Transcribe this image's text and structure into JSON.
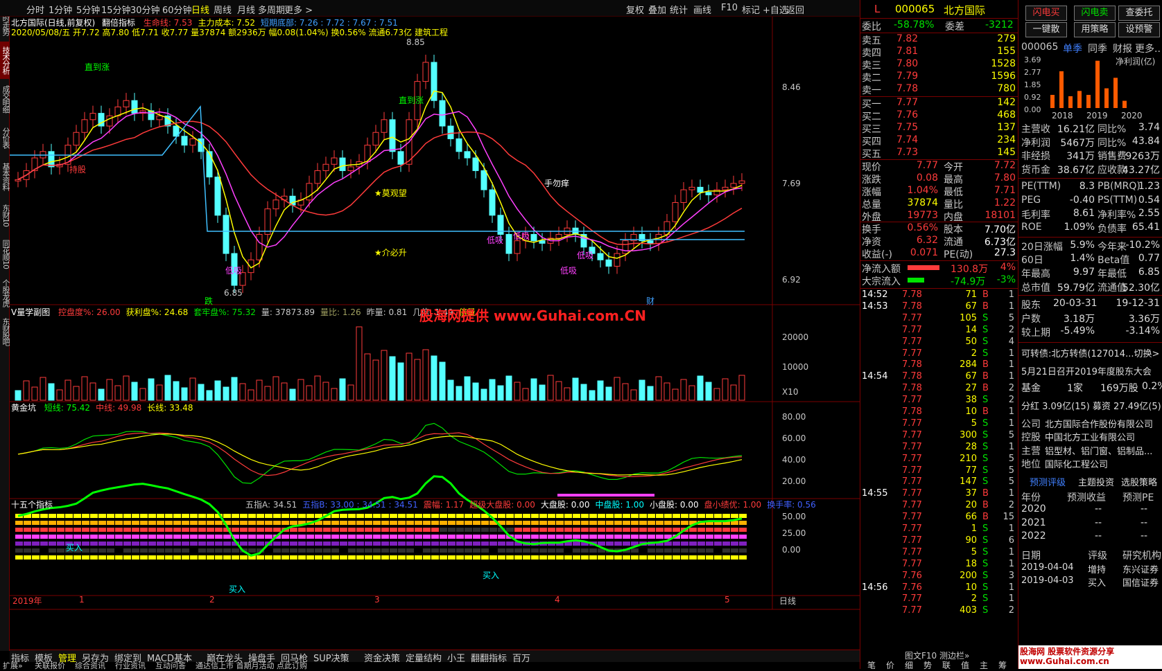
{
  "topbar": {
    "periods": [
      "分时",
      "1分钟",
      "5分钟",
      "15分钟",
      "30分钟",
      "60分钟",
      "日线",
      "周线",
      "月线",
      "多周期",
      "更多 >"
    ],
    "active": "日线",
    "tools": [
      "复权",
      "叠加",
      "统计",
      "画线",
      "F10",
      "标记",
      "+自选",
      "返回"
    ]
  },
  "leftnav": [
    "分时走势",
    "技术分析",
    "成交明细",
    "分价表",
    "基本资料",
    "东财10",
    "同花顺10",
    "个股龙虎",
    "东财股吧"
  ],
  "main": {
    "title": "北方国际(日线,前复权)",
    "indicator": "翻倍指标",
    "ind_values": [
      {
        "t": "生命线: 7.53",
        "c": "#ff3b3b"
      },
      {
        "t": "主力成本: 7.52",
        "c": "#ffff00"
      },
      {
        "t": "短期底部: 7.26 : 7.72 : 7.67 : 7.51",
        "c": "#40a0ff"
      }
    ],
    "ohlc": "2020/05/08/五 开7.72 高7.80 低7.71 收7.77 量37874 额2936万 幅0.08(1.04%) 换0.56% 流通6.73亿 建筑工程",
    "price_labels": [
      "8.46",
      "7.69",
      "6.92"
    ],
    "annotations": [
      {
        "t": "直到涨",
        "c": "#00ff00"
      },
      {
        "t": "持股",
        "c": "#ff3b3b"
      },
      {
        "t": "8.85",
        "c": "#c8c8c8"
      },
      {
        "t": "直到涨",
        "c": "#00ff00"
      },
      {
        "t": "★莫观望",
        "c": "#ffff00"
      },
      {
        "t": "★介必升",
        "c": "#ffff00"
      },
      {
        "t": "手勿痒",
        "c": "#ffffff"
      },
      {
        "t": "低吸",
        "c": "#ff40ff"
      },
      {
        "t": "低吸",
        "c": "#ff40ff"
      },
      {
        "t": "低吸",
        "c": "#ff40ff"
      },
      {
        "t": "低吸",
        "c": "#ff40ff"
      },
      {
        "t": "低吸",
        "c": "#ff40ff"
      },
      {
        "t": "6.85",
        "c": "#c8c8c8"
      },
      {
        "t": "跌",
        "c": "#00ff00"
      },
      {
        "t": "财",
        "c": "#40a0ff"
      }
    ]
  },
  "vol": {
    "title": "V量学副图",
    "items": [
      {
        "t": "控盘度%: 26.00",
        "c": "#ff3b3b"
      },
      {
        "t": "获利盘%: 24.68",
        "c": "#ffff00"
      },
      {
        "t": "套牢盘%: 75.32",
        "c": "#00e400"
      },
      {
        "t": "量: 37873.89",
        "c": "#c8c8c8"
      },
      {
        "t": "量比: 1.26",
        "c": "#a0a060"
      },
      {
        "t": "昨量: 0.81",
        "c": "#c8c8c8"
      },
      {
        "t": "几倍: 1.49",
        "c": "#c8c8c8"
      },
      {
        "t": "倍量",
        "c": "#ffff00"
      }
    ],
    "watermark": "股海网提供 www.Guhai.com.CN",
    "labels": [
      "20000",
      "10000",
      "X10"
    ]
  },
  "gold": {
    "title": "黄金坑",
    "items": [
      {
        "t": "短线: 75.42",
        "c": "#00ff00"
      },
      {
        "t": "中线: 49.98",
        "c": "#ff3b3b"
      },
      {
        "t": "长线: 33.48",
        "c": "#ffff00"
      }
    ],
    "labels": [
      "80.00",
      "60.00",
      "40.00",
      "20.00"
    ]
  },
  "fifteen": {
    "title": "十五个指标",
    "items": [
      {
        "t": "五指A: 34.51",
        "c": "#c8c8c8"
      },
      {
        "t": "五指B: 33.00 : 34.51 : 34.51",
        "c": "#4060ff"
      },
      {
        "t": "震幅: 1.17",
        "c": "#ff3b3b"
      },
      {
        "t": "超级大盘股: 0.00",
        "c": "#ff3b3b"
      },
      {
        "t": "大盘股: 0.00",
        "c": "#ffffff"
      },
      {
        "t": "中盘股: 1.00",
        "c": "#00ffff"
      },
      {
        "t": "小盘股: 0.00",
        "c": "#ffffff"
      },
      {
        "t": "盘小绩优: 1.00",
        "c": "#ff3b3b"
      },
      {
        "t": "换手率: 0.56",
        "c": "#4060ff"
      }
    ],
    "labels": [
      "50.00",
      "25.00",
      "0.00"
    ],
    "buy": [
      "买入",
      "买入",
      "买入"
    ]
  },
  "xaxis": {
    "labels": [
      "2019年",
      "1",
      "2",
      "3",
      "4",
      "5"
    ],
    "right": "日线"
  },
  "bottom_tabs": [
    "指标",
    "模板",
    "管理",
    "另存为",
    "绑定到",
    "MACD基本",
    "巅在龙头",
    "操盘手",
    "回马枪",
    "SUP决策",
    "资金决策",
    "定量结构",
    "小王",
    "翻翻指标",
    "百万"
  ],
  "status": [
    "扩展»",
    "关联报价",
    "综合资讯",
    "行业资讯",
    "互动问答",
    "通达信上市 首期月活动 点此订购"
  ],
  "quote": {
    "code": "000065",
    "name": "北方国际",
    "flag": "L",
    "weibi": "-58.78%",
    "weicha": "-3212",
    "sells": [
      [
        "卖五",
        "7.82",
        "279"
      ],
      [
        "卖四",
        "7.81",
        "155"
      ],
      [
        "卖三",
        "7.80",
        "1528"
      ],
      [
        "卖二",
        "7.79",
        "1596"
      ],
      [
        "卖一",
        "7.78",
        "780"
      ]
    ],
    "buys": [
      [
        "买一",
        "7.77",
        "142"
      ],
      [
        "买二",
        "7.76",
        "468"
      ],
      [
        "买三",
        "7.75",
        "137"
      ],
      [
        "买四",
        "7.74",
        "234"
      ],
      [
        "买五",
        "7.73",
        "145"
      ]
    ],
    "stats": [
      [
        "现价",
        "7.77",
        "今开",
        "7.72"
      ],
      [
        "涨跌",
        "0.08",
        "最高",
        "7.80"
      ],
      [
        "涨幅",
        "1.04%",
        "最低",
        "7.71"
      ],
      [
        "总量",
        "37874",
        "量比",
        "1.22"
      ],
      [
        "外盘",
        "19773",
        "内盘",
        "18101"
      ]
    ],
    "stats2": [
      [
        "换手",
        "0.56%",
        "股本",
        "7.70亿"
      ],
      [
        "净资",
        "6.32",
        "流通",
        "6.73亿"
      ],
      [
        "收益(-)",
        "0.071",
        "PE(动)",
        "27.3"
      ]
    ],
    "flow": [
      [
        "净流入额",
        "130.8万",
        "4%"
      ],
      [
        "大宗流入",
        "-74.9万",
        "-3%"
      ]
    ],
    "ticks": [
      [
        "14:52",
        "7.78",
        "71",
        "B",
        "1"
      ],
      [
        "14:53",
        "7.78",
        "67",
        "B",
        "1"
      ],
      [
        "",
        "7.77",
        "105",
        "S",
        "5"
      ],
      [
        "",
        "7.77",
        "14",
        "S",
        "2"
      ],
      [
        "",
        "7.77",
        "50",
        "S",
        "4"
      ],
      [
        "",
        "7.77",
        "2",
        "S",
        "1"
      ],
      [
        "",
        "7.78",
        "284",
        "B",
        "1"
      ],
      [
        "14:54",
        "7.78",
        "67",
        "B",
        "1"
      ],
      [
        "",
        "7.78",
        "27",
        "B",
        "2"
      ],
      [
        "",
        "7.77",
        "38",
        "S",
        "2"
      ],
      [
        "",
        "7.78",
        "10",
        "B",
        "1"
      ],
      [
        "",
        "7.77",
        "5",
        "S",
        "1"
      ],
      [
        "",
        "7.77",
        "300",
        "S",
        "5"
      ],
      [
        "",
        "7.77",
        "28",
        "S",
        "1"
      ],
      [
        "",
        "7.77",
        "210",
        "S",
        "5"
      ],
      [
        "",
        "7.77",
        "77",
        "S",
        "5"
      ],
      [
        "",
        "7.77",
        "147",
        "S",
        "5"
      ],
      [
        "14:55",
        "7.77",
        "37",
        "B",
        "1"
      ],
      [
        "",
        "7.77",
        "20",
        "B",
        "2"
      ],
      [
        "",
        "7.77",
        "66",
        "B",
        "15"
      ],
      [
        "",
        "7.77",
        "1",
        "S",
        "1"
      ],
      [
        "",
        "7.77",
        "90",
        "S",
        "6"
      ],
      [
        "",
        "7.77",
        "5",
        "S",
        "1"
      ],
      [
        "",
        "7.77",
        "18",
        "S",
        "1"
      ],
      [
        "",
        "7.76",
        "200",
        "S",
        "3"
      ],
      [
        "14:56",
        "7.76",
        "10",
        "S",
        "1"
      ],
      [
        "",
        "7.77",
        "2",
        "S",
        "1"
      ],
      [
        "",
        "7.77",
        "403",
        "S",
        "2"
      ]
    ],
    "bottom": "图文F10 测边栏»",
    "bottom_tabs": [
      "笔",
      "价",
      "细",
      "势",
      "联",
      "值",
      "主",
      "筹"
    ]
  },
  "side": {
    "buttons": [
      "闪电买",
      "闪电卖",
      "查委托",
      "一键散",
      "用策略",
      "设预警"
    ],
    "tabs": [
      "000065",
      "单季",
      "同季",
      "财报",
      "更多.."
    ],
    "chart_title": "净利润(亿)",
    "chart_y": [
      "3.69",
      "2.77",
      "1.85",
      "0.92",
      "0.00"
    ],
    "chart_x": [
      "2018",
      "2019",
      "2020"
    ],
    "chart_data": {
      "type": "bar",
      "categories": [
        "2018Q1",
        "2018Q2",
        "2018Q3",
        "2018Q4",
        "2019Q1",
        "2019Q2",
        "2019Q3",
        "2019Q4",
        "2020Q1"
      ],
      "values": [
        1.0,
        2.8,
        0.9,
        1.3,
        1.0,
        3.6,
        1.5,
        2.3,
        0.55
      ],
      "ylim": [
        0,
        3.69
      ]
    },
    "fin": [
      [
        "主营收",
        "16.21亿",
        "同比%",
        "3.74"
      ],
      [
        "净利润",
        "5467万",
        "同比%",
        "43.84"
      ],
      [
        "非经损",
        "341万",
        "销售费",
        "9263万"
      ],
      [
        "货币金",
        "38.67亿",
        "应收款",
        "43.27亿"
      ],
      [
        "PE(TTM)",
        "8.3",
        "PB(MRQ)",
        "1.23"
      ],
      [
        "PEG",
        "-0.40",
        "PS(TTM)",
        "0.54"
      ],
      [
        "毛利率",
        "8.61",
        "净利率%",
        "2.55"
      ],
      [
        "ROE",
        "1.09%",
        "负债率",
        "65.41"
      ],
      [
        "20日涨幅",
        "5.9%",
        "今年来",
        "-10.2%"
      ],
      [
        "60日",
        "1.4%",
        "Beta值",
        "0.77"
      ],
      [
        "年最高",
        "9.97",
        "年最低",
        "6.85"
      ],
      [
        "总市值",
        "59.79亿",
        "流通值",
        "52.30亿"
      ],
      [
        "股东",
        "20-03-31",
        "",
        "19-12-31"
      ],
      [
        "户数",
        "3.18万",
        "",
        "3.36万"
      ],
      [
        "较上期",
        "-5.49%",
        "",
        "-3.14%"
      ]
    ],
    "bond": "可转债:北方转债(127014...切换>",
    "meeting": "5月21日召开2019年度股东大会",
    "fund": [
      "基金",
      "1家",
      "169万股",
      "0.2%"
    ],
    "dividend": "分红 3.09亿(15) 募资 27.49亿(5)",
    "company": [
      [
        "公司",
        "北方国际合作股份有限公司"
      ],
      [
        "控股",
        "中国北方工业有限公司"
      ],
      [
        "主营",
        "铝型材、铝门窗、铝制品..."
      ],
      [
        "地位",
        "国际化工程公司"
      ]
    ],
    "forecast_tabs": [
      "预测评级",
      "主题投资",
      "选股策略"
    ],
    "forecast_head": [
      "年份",
      "预测收益",
      "预测PE"
    ],
    "forecast": [
      [
        "2020",
        "--",
        "--"
      ],
      [
        "2021",
        "--",
        "--"
      ],
      [
        "2022",
        "--",
        "--"
      ]
    ],
    "rating_head": [
      "日期",
      "评级",
      "研究机构"
    ],
    "ratings": [
      [
        "2019-04-04",
        "增持",
        "东兴证券"
      ],
      [
        "2019-04-03",
        "买入",
        "国信证券"
      ]
    ],
    "logo": "股海网 股票软件资源分享 www.Guhai.com.cn"
  }
}
